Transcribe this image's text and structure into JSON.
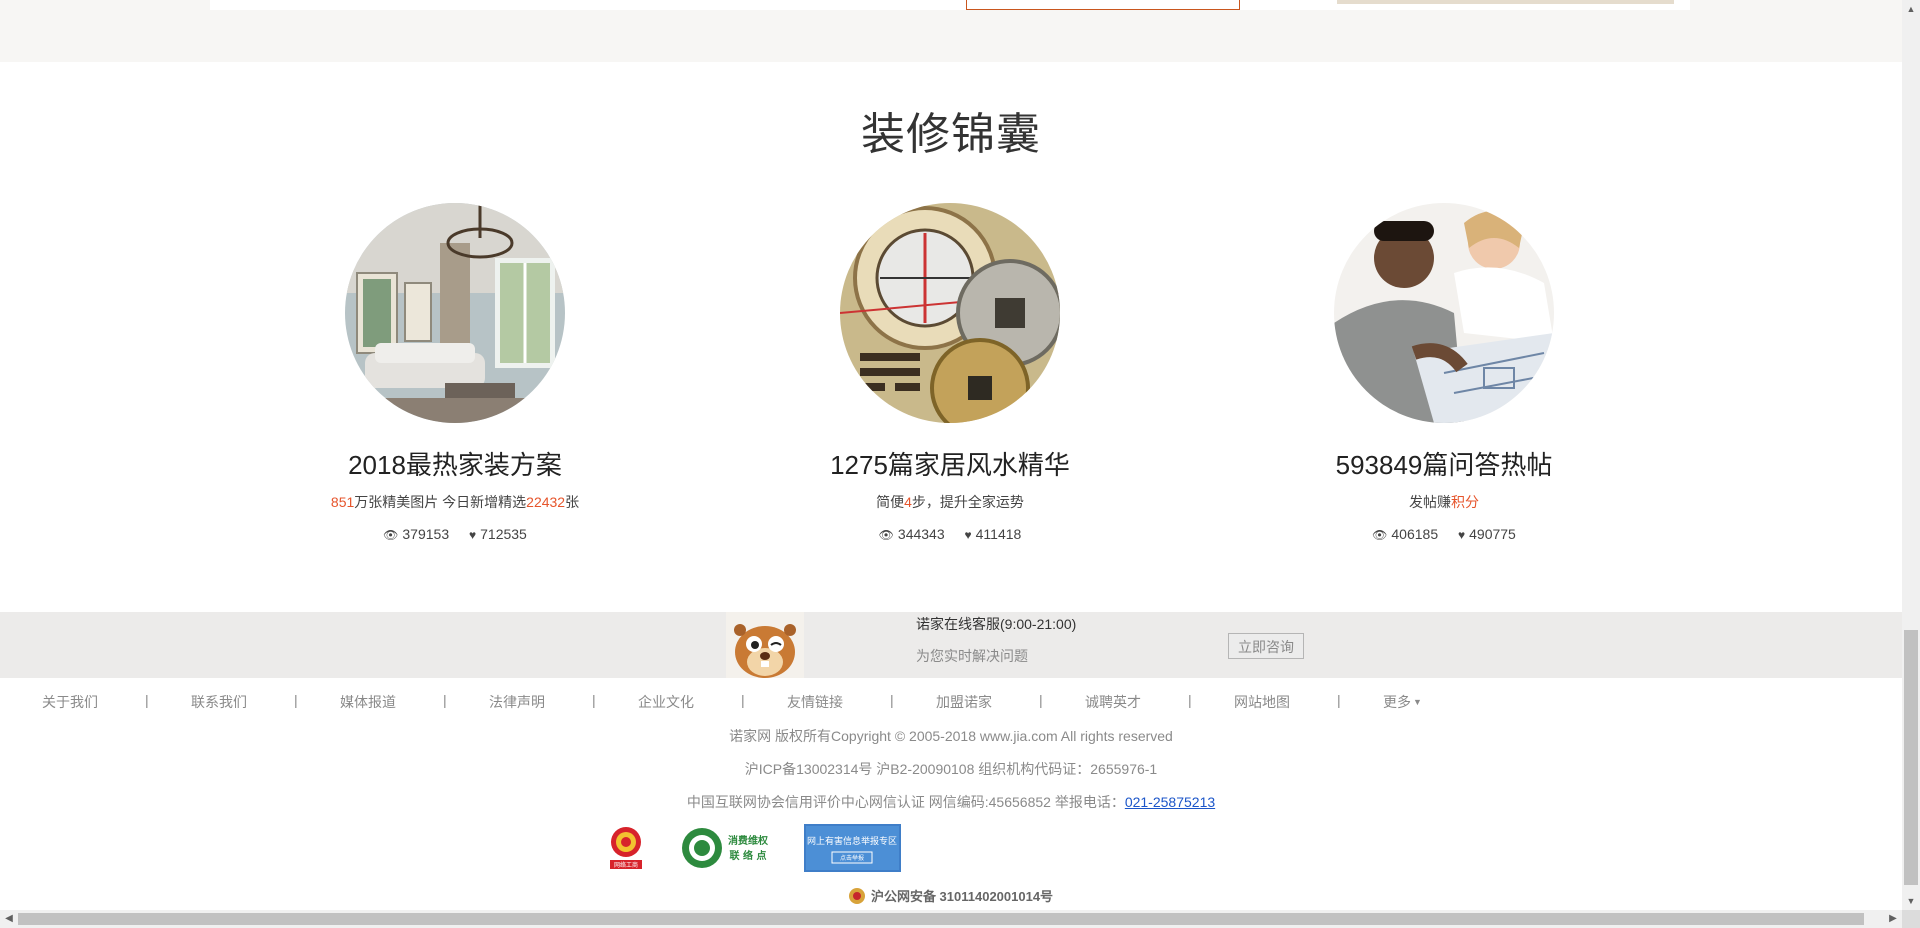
{
  "section": {
    "title": "装修锦囊"
  },
  "cards": [
    {
      "title": "2018最热家装方案",
      "sub_num1": "851",
      "sub_text1": "万张精美图片  今日新增精选",
      "sub_num2": "22432",
      "sub_text2": "张",
      "views": "379153",
      "likes": "712535",
      "image_icon": "living-room-photo"
    },
    {
      "title": "1275篇家居风水精华",
      "sub_text1": "简便",
      "sub_num1": "4",
      "sub_text2": "步，提升全家运势",
      "views": "344343",
      "likes": "411418",
      "image_icon": "fengshui-compass-photo"
    },
    {
      "title": "593849篇问答热帖",
      "sub_text1": "发帖赚",
      "sub_num1": "积分",
      "views": "406185",
      "likes": "490775",
      "image_icon": "consultation-photo"
    }
  ],
  "service": {
    "title": "诺家在线客服(9:00-21:00)",
    "subtitle": "为您实时解决问题",
    "button": "立即咨询"
  },
  "footer_nav": {
    "links": [
      "关于我们",
      "联系我们",
      "媒体报道",
      "法律声明",
      "企业文化",
      "友情链接",
      "加盟诺家",
      "诚聘英才",
      "网站地图",
      "更多"
    ],
    "separator": "|"
  },
  "footer": {
    "copyright": "诺家网 版权所有Copyright © 2005-2018 www.jia.com All rights reserved",
    "icp": "沪ICP备13002314号 沪B2-20090108 组织机构代码证：2655976-1",
    "credit_prefix": "中国互联网协会信用评价中心网信认证 网信编码:45656852 举报电话：",
    "report_phone": "021-25875213",
    "police": "沪公网安备 31011402001014号"
  },
  "badges": {
    "business": "网络工商",
    "consumer_line1": "消费维权",
    "consumer_line2": "联 络 点",
    "report_line1": "网上有害信息举报专区",
    "report_line2": "点击举报"
  },
  "colors": {
    "accent": "#e6552c",
    "link": "#1c56c9",
    "service_bg": "#ecebea"
  }
}
